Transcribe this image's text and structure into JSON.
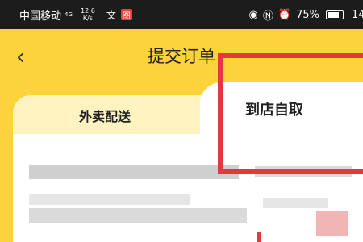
{
  "status_bar": {
    "carrier": "中国移动",
    "network": "4G",
    "speed_value": "12.6",
    "speed_unit": "K/s",
    "text_icon": "文",
    "app_icon": "图",
    "battery": "75%",
    "time": "14"
  },
  "header": {
    "title": "提交订单"
  },
  "tabs": [
    {
      "label": "外卖配送",
      "active": false
    },
    {
      "label": "到店自取",
      "active": true
    }
  ],
  "colors": {
    "accent": "#fdd33b",
    "highlight": "#e0393f"
  }
}
